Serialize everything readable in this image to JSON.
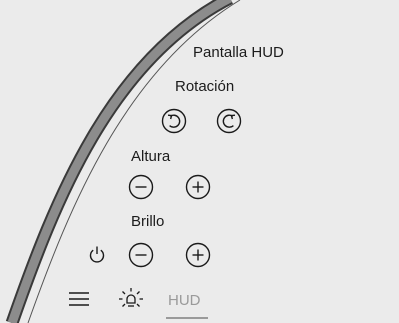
{
  "hud_panel": {
    "title": "Pantalla HUD",
    "rotation": {
      "label": "Rotación",
      "rotate_ccw_icon": "rotate-counterclockwise-icon",
      "rotate_cw_icon": "rotate-clockwise-icon"
    },
    "height": {
      "label": "Altura",
      "decrease_icon": "minus-circle-icon",
      "increase_icon": "plus-circle-icon"
    },
    "brightness": {
      "label": "Brillo",
      "power_icon": "power-icon",
      "decrease_icon": "minus-circle-icon",
      "increase_icon": "plus-circle-icon"
    }
  },
  "bottom_bar": {
    "menu_icon": "menu-icon",
    "brightness_icon": "sun-icon",
    "hud_tab_label": "HUD"
  },
  "colors": {
    "background": "#ebebeb",
    "foreground": "#1a1a1a",
    "inactive": "#9a9a9a",
    "bezel_band": "#8c8c8c"
  }
}
